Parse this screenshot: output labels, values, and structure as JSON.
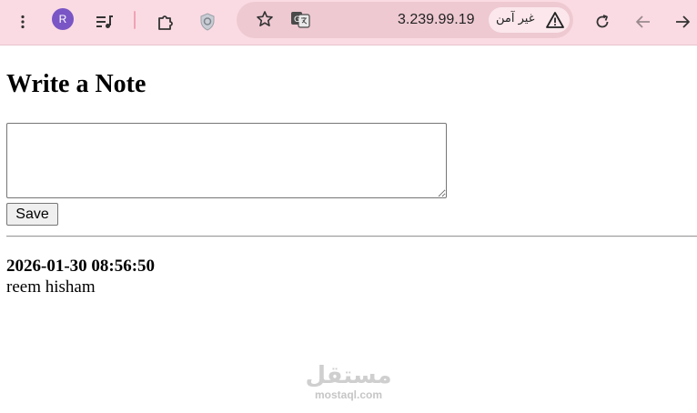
{
  "browser": {
    "profile_initial": "R",
    "url": "3.239.99.19",
    "security_label": "غير آمن",
    "icons": {
      "menu": "more-vert-icon",
      "media": "media-queue-icon",
      "extensions": "puzzle-icon",
      "shield": "shield-icon",
      "bookmark": "star-icon",
      "translate": "translate-icon",
      "warning": "warning-icon",
      "reload": "reload-icon",
      "back": "back-arrow-icon",
      "forward": "forward-arrow-icon"
    },
    "colors": {
      "toolbar_bg": "#fbdbe3",
      "omnibox_bg": "#eec9d2",
      "avatar_bg": "#7a55c5"
    }
  },
  "page": {
    "title": "Write a Note",
    "note_input_value": "",
    "save_label": "Save",
    "notes": [
      {
        "timestamp": "2026-01-30 08:56:50",
        "text": "reem hisham"
      }
    ]
  },
  "watermark": {
    "logo_text": "مستقل",
    "domain": "mostaql.com"
  }
}
